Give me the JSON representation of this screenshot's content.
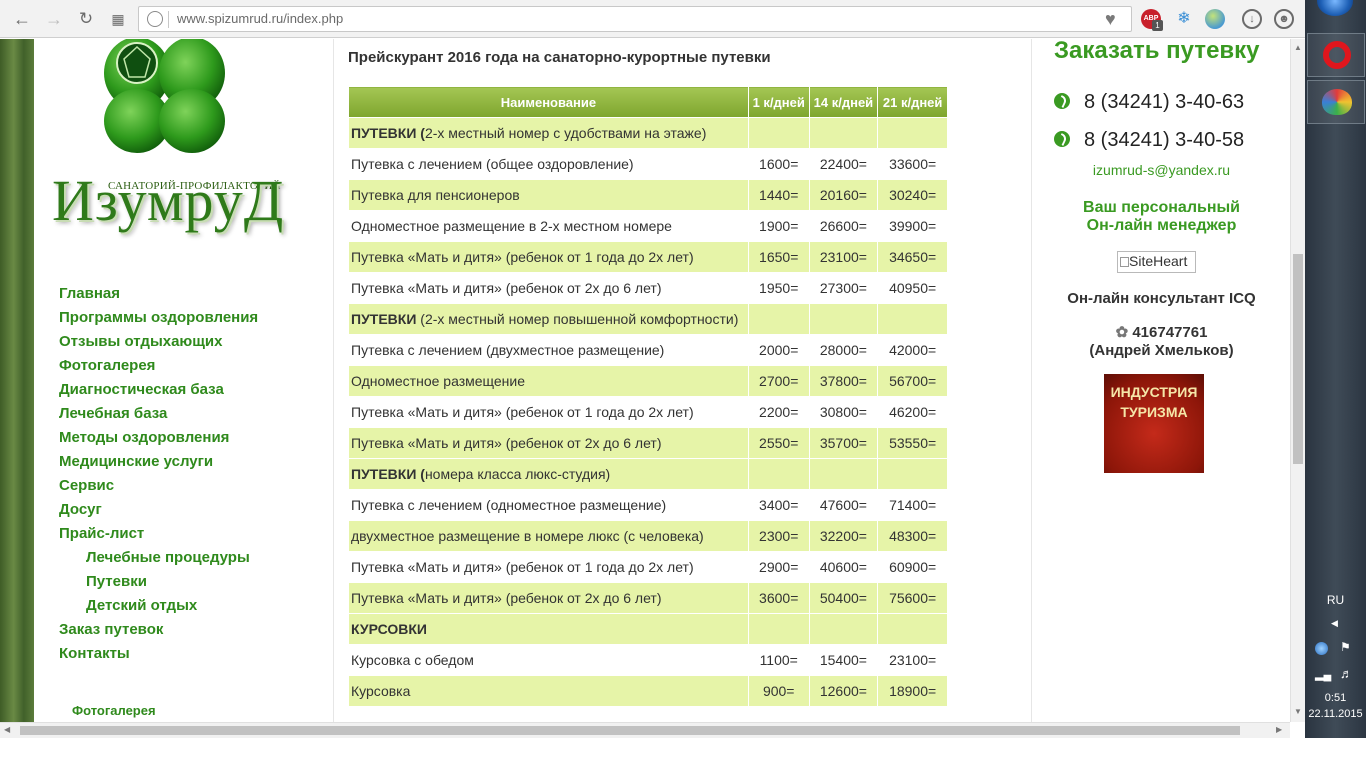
{
  "browser": {
    "url": "www.spizumrud.ru/index.php",
    "extensions": [
      "abp-icon",
      "weather-icon",
      "globe-icon"
    ],
    "abp_badge": "ABP",
    "abp_count": "1"
  },
  "logo": {
    "subtitle": "САНАТОРИЙ-ПРОФИЛАКТОРИЙ",
    "name": "ИзумруД"
  },
  "nav": {
    "items": [
      {
        "label": "Главная"
      },
      {
        "label": "Программы оздоровления"
      },
      {
        "label": "Отзывы отдыхающих"
      },
      {
        "label": "Фотогалерея"
      },
      {
        "label": "Диагностическая база"
      },
      {
        "label": "Лечебная база"
      },
      {
        "label": "Методы оздоровления"
      },
      {
        "label": "Медицинские услуги"
      },
      {
        "label": "Сервис"
      },
      {
        "label": "Досуг"
      },
      {
        "label": "Прайс-лист"
      },
      {
        "label": "Лечебные процедуры"
      },
      {
        "label": "Путевки"
      },
      {
        "label": "Детский отдых"
      },
      {
        "label": "Заказ путевок"
      },
      {
        "label": "Контакты"
      }
    ],
    "photo_link": "Фотогалерея"
  },
  "main": {
    "title": "Прейскурант 2016 года на санаторно-курортные путевки",
    "table": {
      "headers": [
        "Наименование",
        "1 к/дней",
        "14 к/дней",
        "21 к/дней"
      ],
      "rows": [
        {
          "type": "section",
          "bold": "ПУТЕВКИ (",
          "rest": "2-х местный номер с удобствами на этаже)"
        },
        {
          "type": "row",
          "name": "Путевка с лечением  (общее оздоровление)",
          "v1": "1600=",
          "v14": "22400=",
          "v21": "33600="
        },
        {
          "type": "row",
          "name": "Путевка для пенсионеров",
          "v1": "1440=",
          "v14": "20160=",
          "v21": "30240="
        },
        {
          "type": "row",
          "name": "Одноместное размещение в 2-х местном номере",
          "v1": "1900=",
          "v14": "26600=",
          "v21": "39900="
        },
        {
          "type": "row",
          "name": "Путевка «Мать и дитя» (ребенок от 1 года до 2х лет)",
          "v1": "1650=",
          "v14": "23100=",
          "v21": "34650="
        },
        {
          "type": "row",
          "name": "Путевка «Мать и дитя» (ребенок от 2х до 6 лет)",
          "v1": "1950=",
          "v14": "27300=",
          "v21": "40950="
        },
        {
          "type": "section",
          "bold": "ПУТЕВКИ",
          "rest": " (2-х местный номер повышенной комфортности)"
        },
        {
          "type": "row",
          "name": "Путевка с лечением (двухместное размещение)",
          "v1": "2000=",
          "v14": "28000=",
          "v21": "42000="
        },
        {
          "type": "row",
          "name": "Одноместное размещение",
          "v1": "2700=",
          "v14": "37800=",
          "v21": "56700="
        },
        {
          "type": "row",
          "name": "Путевка «Мать и дитя» (ребенок от 1 года до 2х лет)",
          "v1": "2200=",
          "v14": "30800=",
          "v21": "46200="
        },
        {
          "type": "row",
          "name": "Путевка «Мать и дитя» (ребенок от 2х до 6 лет)",
          "v1": "2550=",
          "v14": "35700=",
          "v21": "53550="
        },
        {
          "type": "section",
          "bold": "ПУТЕВКИ (",
          "rest": "номера класса люкс-студия)"
        },
        {
          "type": "row",
          "name": "Путевка с лечением (одноместное размещение)",
          "v1": "3400=",
          "v14": "47600=",
          "v21": "71400="
        },
        {
          "type": "row",
          "name": "двухместное размещение в номере люкс (с человека)",
          "v1": "2300=",
          "v14": "32200=",
          "v21": "48300="
        },
        {
          "type": "row",
          "name": "Путевка «Мать и дитя» (ребенок от 1 года до 2х лет)",
          "v1": "2900=",
          "v14": "40600=",
          "v21": "60900="
        },
        {
          "type": "row",
          "name": "Путевка «Мать и дитя» (ребенок от 2х до 6 лет)",
          "v1": "3600=",
          "v14": "50400=",
          "v21": "75600="
        },
        {
          "type": "section",
          "bold": "КУРСОВКИ",
          "rest": ""
        },
        {
          "type": "row",
          "name": "Курсовка с обедом",
          "v1": "1100=",
          "v14": "15400=",
          "v21": "23100="
        },
        {
          "type": "row",
          "name": "Курсовка",
          "v1": "900=",
          "v14": "12600=",
          "v21": "18900="
        }
      ]
    }
  },
  "right": {
    "order_title": "Заказать путевку",
    "phone1": "8   (34241)  3-40-63",
    "phone2": "8   (34241)  3-40-58",
    "email": "izumrud-s@yandex.ru",
    "manager_line1": "Ваш персональный",
    "manager_line2": "Он-лайн менеджер",
    "siteheart_alt": "SiteHeart",
    "icq_title": "Он-лайн консультант ICQ",
    "icq_number": "416747761",
    "icq_name": "(Андрей Хмельков)",
    "banner_line1": "ИНДУСТРИЯ",
    "banner_line2": "ТУРИЗМА"
  },
  "taskbar": {
    "lang": "RU",
    "time": "0:51",
    "date": "22.11.2015"
  },
  "colors": {
    "brand_green": "#3a9a22",
    "header_green": "#8cb33a",
    "row_shade": "#e6f4a8"
  }
}
